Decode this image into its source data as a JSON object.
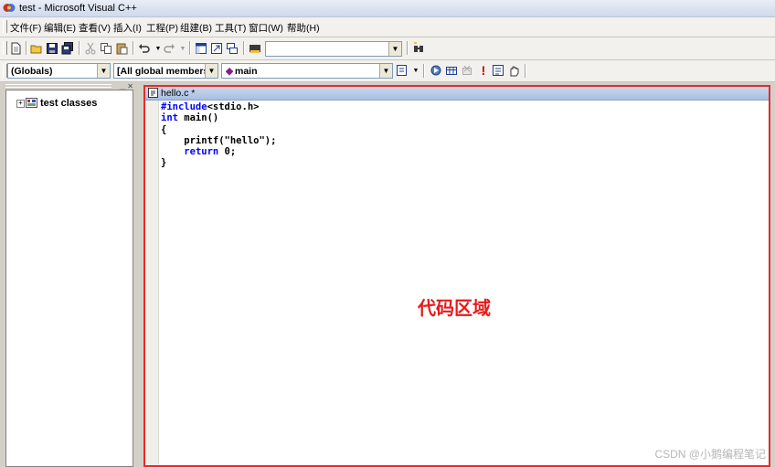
{
  "window": {
    "title": "test - Microsoft Visual C++"
  },
  "menu": [
    {
      "label": "文件(F)"
    },
    {
      "label": "编辑(E)"
    },
    {
      "label": "查看(V)"
    },
    {
      "label": "插入(I)"
    },
    {
      "label": "工程(P)"
    },
    {
      "label": "组建(B)"
    },
    {
      "label": "工具(T)"
    },
    {
      "label": "窗口(W)"
    },
    {
      "label": "帮助(H)"
    }
  ],
  "wizardbar": {
    "scope": "(Globals)",
    "members": "[All global members",
    "function": "main"
  },
  "toolbar": {
    "find_value": ""
  },
  "workspace": {
    "tree_root": "test classes"
  },
  "editor": {
    "tab_title": "hello.c *",
    "code": {
      "line1_kw": "#include",
      "line1_rest": "<stdio.h>",
      "line2_kw": "int",
      "line2_rest": " main()",
      "line3": "{",
      "line4": "    printf(\"hello\");",
      "line5_indent": "    ",
      "line5_kw": "return",
      "line5_rest": " 0;",
      "line6": "}"
    }
  },
  "annotation": {
    "label": "代码区域",
    "color": "#e52b2b"
  },
  "watermark": {
    "text": "CSDN @小鹅编程笔记"
  }
}
